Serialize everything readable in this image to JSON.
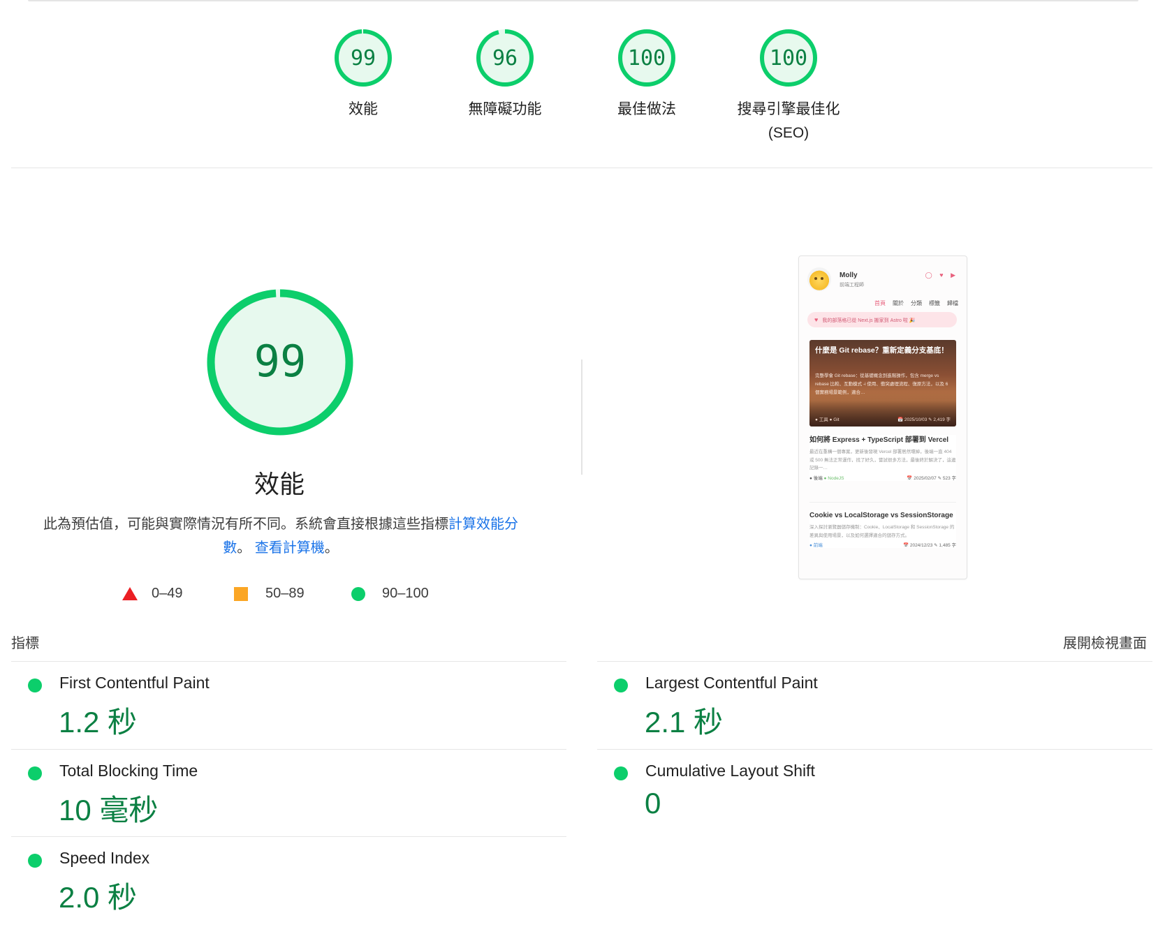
{
  "categories": [
    {
      "score": 99,
      "label": "效能",
      "sublabel": ""
    },
    {
      "score": 96,
      "label": "無障礙功能",
      "sublabel": ""
    },
    {
      "score": 100,
      "label": "最佳做法",
      "sublabel": ""
    },
    {
      "score": 100,
      "label": "搜尋引擎最佳化",
      "sublabel": "(SEO)"
    }
  ],
  "performance": {
    "score": 99,
    "title": "效能",
    "description_prefix": "此為預估值，可能與實際情況有所不同。系統會直接根據這些指標",
    "calc_link": "計算效能分數",
    "description_mid": "。",
    "calculator_link": "查看計算機",
    "description_suffix": "。"
  },
  "legend": [
    {
      "range": "0–49",
      "shape": "triangle",
      "color": "#eb1f24"
    },
    {
      "range": "50–89",
      "shape": "square",
      "color": "#fba625"
    },
    {
      "range": "90–100",
      "shape": "circle",
      "color": "#0cce6b"
    }
  ],
  "preview": {
    "name": "Molly",
    "role": "前端工程師",
    "icons": "◯ ♥ ▶",
    "nav": [
      "首頁",
      "關於",
      "分類",
      "標籤",
      "歸檔"
    ],
    "banner": "我的部落格已從 Next.js 搬家到 Astro 啦 🎉",
    "hero": {
      "title": "什麼是 Git rebase？重新定義分支基底！",
      "desc": "完整學會 Git rebase：從基礎概念到進階操作，包含 merge vs rebase 比較、互動模式 -i 使用、衝突處理流程、復原方法，以及 6 個實務場景範例，適合…",
      "tags": "● 工具  ● Git",
      "meta": "📅 2025/10/03  ✎ 2,419 字"
    },
    "posts": [
      {
        "title": "如何將 Express + TypeScript 部署到 Vercel",
        "desc": "最近在重構一個專案，更新後發現 Vercel 部署居然壞掉，後端一直 404 或 500 無法正常運作，找了好久，嘗試很多方法，最後終於解決了，這邊記錄一…",
        "tag1": "● 後端",
        "tag2": "● NodeJS",
        "meta": "📅 2025/02/07  ✎ 523 字"
      },
      {
        "title": "Cookie vs LocalStorage vs SessionStorage",
        "desc": "深入探討瀏覽器儲存機制：Cookie、LocalStorage 和 SessionStorage 的差異與使用場景，以及如何選擇適合的儲存方式。",
        "tag1": "● 前端",
        "tag2": "",
        "meta": "📅 2024/12/23  ✎ 1,485 字"
      }
    ]
  },
  "metrics_section": {
    "heading": "指標",
    "expand": "展開檢視畫面"
  },
  "metrics": [
    {
      "name": "First Contentful Paint",
      "value": "1.2 秒",
      "status": "pass"
    },
    {
      "name": "Largest Contentful Paint",
      "value": "2.1 秒",
      "status": "pass"
    },
    {
      "name": "Total Blocking Time",
      "value": "10 毫秒",
      "status": "pass"
    },
    {
      "name": "Cumulative Layout Shift",
      "value": "0",
      "status": "pass"
    },
    {
      "name": "Speed Index",
      "value": "2.0 秒",
      "status": "pass"
    }
  ],
  "colors": {
    "pass": "#0cce6b",
    "pass_text": "#0b8043",
    "pass_bg": "#e7f9ee",
    "link": "#1a73e8"
  }
}
